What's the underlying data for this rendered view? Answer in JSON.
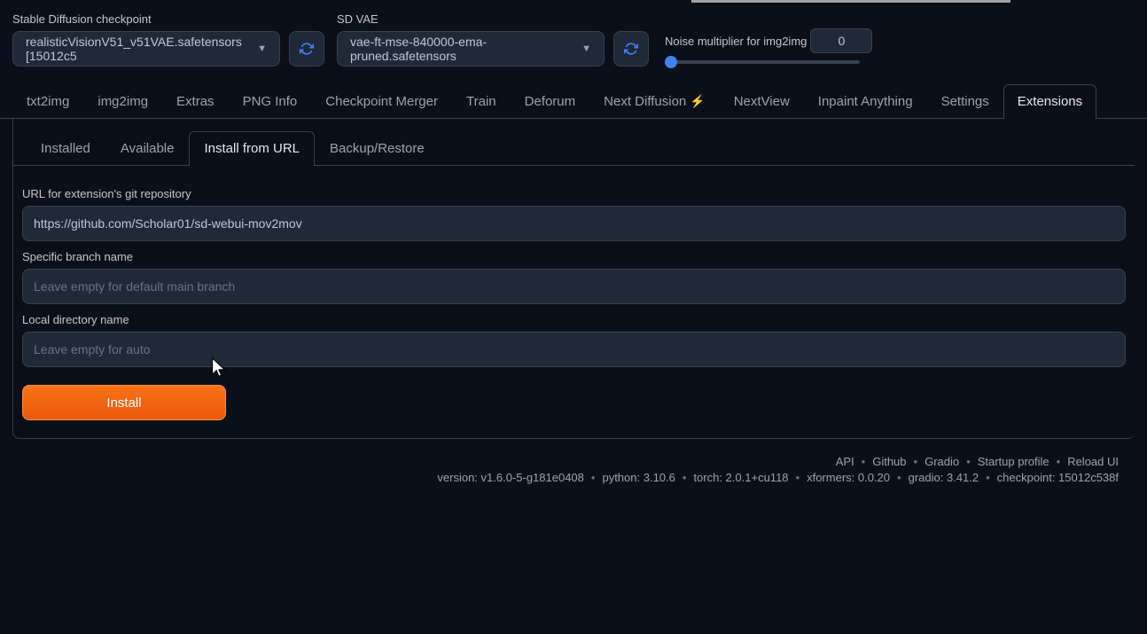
{
  "header": {
    "checkpoint_label": "Stable Diffusion checkpoint",
    "checkpoint_value": "realisticVisionV51_v51VAE.safetensors [15012c5",
    "vae_label": "SD VAE",
    "vae_value": "vae-ft-mse-840000-ema-pruned.safetensors",
    "noise_label": "Noise multiplier for img2img",
    "noise_value": "0"
  },
  "main_tabs": [
    "txt2img",
    "img2img",
    "Extras",
    "PNG Info",
    "Checkpoint Merger",
    "Train",
    "Deforum",
    "Next Diffusion",
    "NextView",
    "Inpaint Anything",
    "Settings",
    "Extensions"
  ],
  "main_tab_active": 11,
  "sub_tabs": [
    "Installed",
    "Available",
    "Install from URL",
    "Backup/Restore"
  ],
  "sub_tab_active": 2,
  "form": {
    "url_label": "URL for extension's git repository",
    "url_value": "https://github.com/Scholar01/sd-webui-mov2mov",
    "branch_label": "Specific branch name",
    "branch_placeholder": "Leave empty for default main branch",
    "dir_label": "Local directory name",
    "dir_placeholder": "Leave empty for auto",
    "install_label": "Install"
  },
  "footer": {
    "links": [
      "API",
      "Github",
      "Gradio",
      "Startup profile",
      "Reload UI"
    ],
    "versions": {
      "version": "version: v1.6.0-5-g181e0408",
      "python": "python: 3.10.6",
      "torch": "torch: 2.0.1+cu118",
      "xformers": "xformers: 0.0.20",
      "gradio": "gradio: 3.41.2",
      "checkpoint": "checkpoint: 15012c538f"
    }
  }
}
